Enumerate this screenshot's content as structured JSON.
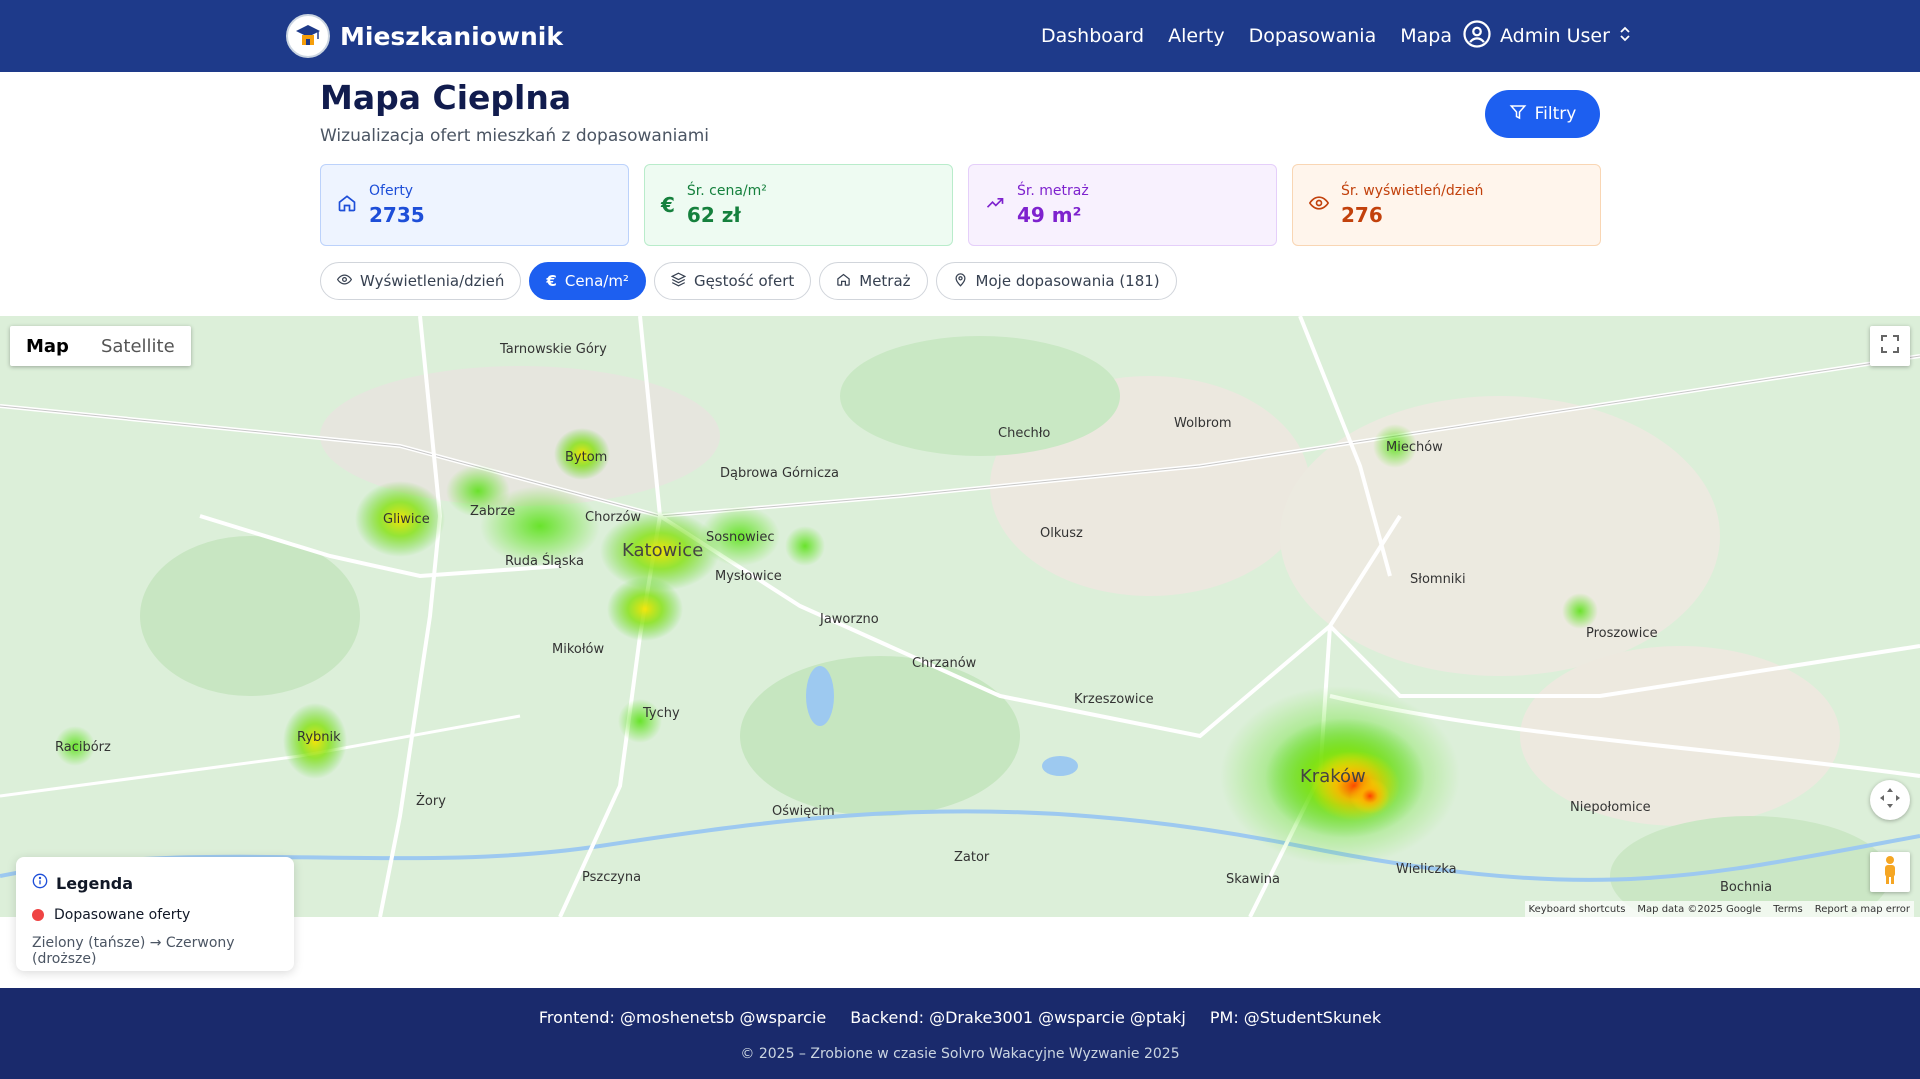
{
  "brand": {
    "name": "Mieszkaniownik"
  },
  "nav": {
    "links": [
      "Dashboard",
      "Alerty",
      "Dopasowania",
      "Mapa"
    ],
    "user": "Admin User"
  },
  "header": {
    "title": "Mapa Cieplna",
    "subtitle": "Wizualizacja ofert mieszkań z dopasowaniami",
    "filter_label": "Filtry"
  },
  "stats": [
    {
      "label": "Oferty",
      "value": "2735",
      "icon": "home-icon",
      "color": "#1d4ed8"
    },
    {
      "label": "Śr. cena/m²",
      "value": "62 zł",
      "icon": "euro-icon",
      "color": "#15803d"
    },
    {
      "label": "Śr. metraż",
      "value": "49 m²",
      "icon": "trending-up-icon",
      "color": "#7e22ce"
    },
    {
      "label": "Śr. wyświetleń/dzień",
      "value": "276",
      "icon": "eye-icon",
      "color": "#c2410c"
    }
  ],
  "tabs": [
    {
      "label": "Wyświetlenia/dzień",
      "icon": "eye-icon",
      "active": false
    },
    {
      "label": "Cena/m²",
      "icon": "euro-icon",
      "active": true
    },
    {
      "label": "Gęstość ofert",
      "icon": "layers-icon",
      "active": false
    },
    {
      "label": "Metraż",
      "icon": "home-icon",
      "active": false
    },
    {
      "label": "Moje dopasowania (181)",
      "icon": "map-pin-icon",
      "active": false
    }
  ],
  "map": {
    "type_options": [
      "Map",
      "Satellite"
    ],
    "selected_type": "Map",
    "footer": [
      "Keyboard shortcuts",
      "Map data ©2025 Google",
      "Terms",
      "Report a map error"
    ],
    "cities": [
      "Tarnowskie Góry",
      "Bytom",
      "Zabrze",
      "Gliwice",
      "Chorzów",
      "Katowice",
      "Sosnowiec",
      "Dąbrowa Górnicza",
      "Ruda Śląska",
      "Mysłowice",
      "Tychy",
      "Rybnik",
      "Jaworzno",
      "Chrzanów",
      "Olkusz",
      "Kraków",
      "Wieliczka",
      "Miechów",
      "Oświęcim",
      "Racibórz",
      "Żory",
      "Mikołów",
      "Skawina",
      "Zator",
      "Krzeszowice",
      "Słomniki",
      "Proszowice",
      "Niepołomice",
      "Bochnia",
      "Wolbrom",
      "Chechło",
      "Pszczyna"
    ]
  },
  "legend": {
    "title": "Legenda",
    "item": "Dopasowane oferty",
    "note": "Zielony (tańsze) → Czerwony (droższe)"
  },
  "footer": {
    "credits": [
      "Frontend: @moshenetsb @wsparcie",
      "Backend: @Drake3001 @wsparcie @ptakj",
      "PM: @StudentSkunek"
    ],
    "copyright": "© 2025 – Zrobione w czasie Solvro Wakacyjne Wyzwanie 2025"
  }
}
